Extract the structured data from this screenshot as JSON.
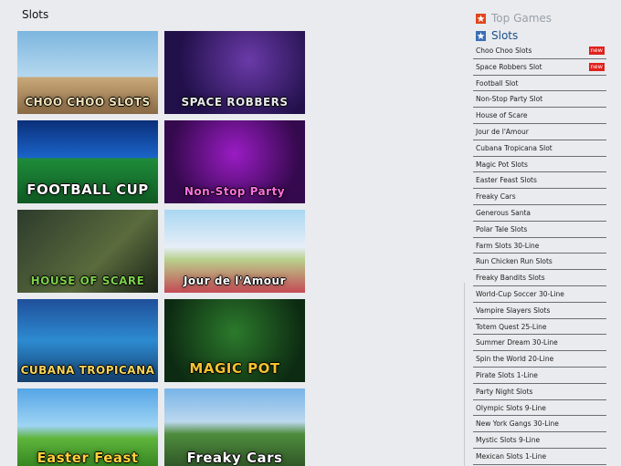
{
  "page": {
    "title": "Slots"
  },
  "games": [
    {
      "name": "CHOO CHOO SLOTS",
      "class": "t-choo",
      "color": "#f2e3b8"
    },
    {
      "name": "SPACE ROBBERS",
      "class": "t-space",
      "color": "#e7e7ef"
    },
    {
      "name": "FOOTBALL CUP",
      "class": "t-football",
      "color": "#ffffff"
    },
    {
      "name": "Non-Stop Party",
      "class": "t-nonstop",
      "color": "#ff6fe4"
    },
    {
      "name": "HOUSE OF SCARE",
      "class": "t-house",
      "color": "#7ed04b"
    },
    {
      "name": "Jour de l'Amour",
      "class": "t-jour",
      "color": "#ffffff"
    },
    {
      "name": "CUBANA TROPICANA",
      "class": "t-cubana",
      "color": "#f6d45a"
    },
    {
      "name": "MAGIC POT",
      "class": "t-magic",
      "color": "#f2c230"
    },
    {
      "name": "Easter Feast",
      "class": "t-easter",
      "color": "#ffd23c"
    },
    {
      "name": "Freaky Cars",
      "class": "t-freaky",
      "color": "#ffffff"
    }
  ],
  "sidebar": {
    "top_games_label": "Top Games",
    "slots_label": "Slots",
    "new_badge": "new",
    "items": [
      {
        "label": "Choo Choo Slots",
        "new": true
      },
      {
        "label": "Space Robbers Slot",
        "new": true
      },
      {
        "label": "Football Slot"
      },
      {
        "label": "Non-Stop Party Slot"
      },
      {
        "label": "House of Scare"
      },
      {
        "label": "Jour de l'Amour"
      },
      {
        "label": "Cubana Tropicana Slot"
      },
      {
        "label": "Magic Pot Slots"
      },
      {
        "label": "Easter Feast Slots"
      },
      {
        "label": "Freaky Cars"
      },
      {
        "label": "Generous Santa"
      },
      {
        "label": "Polar Tale Slots"
      },
      {
        "label": "Farm Slots 30-Line"
      },
      {
        "label": "Run Chicken Run Slots"
      },
      {
        "label": "Freaky Bandits Slots"
      },
      {
        "label": "World-Cup Soccer 30-Line"
      },
      {
        "label": "Vampire Slayers Slots"
      },
      {
        "label": "Totem Quest 25-Line"
      },
      {
        "label": "Summer Dream 30-Line"
      },
      {
        "label": "Spin the World 20-Line"
      },
      {
        "label": "Pirate Slots 1-Line"
      },
      {
        "label": "Party Night Slots"
      },
      {
        "label": "Olympic Slots 9-Line"
      },
      {
        "label": "New York Gangs 30-Line"
      },
      {
        "label": "Mystic Slots 9-Line"
      },
      {
        "label": "Mexican Slots 1-Line"
      }
    ]
  },
  "colors": {
    "top_games_icon": "#e2451b",
    "slots_icon": "#3b6eb6",
    "new_badge": "#e0211c"
  },
  "icons": {
    "top_games": "star-icon",
    "slots": "star-icon"
  }
}
